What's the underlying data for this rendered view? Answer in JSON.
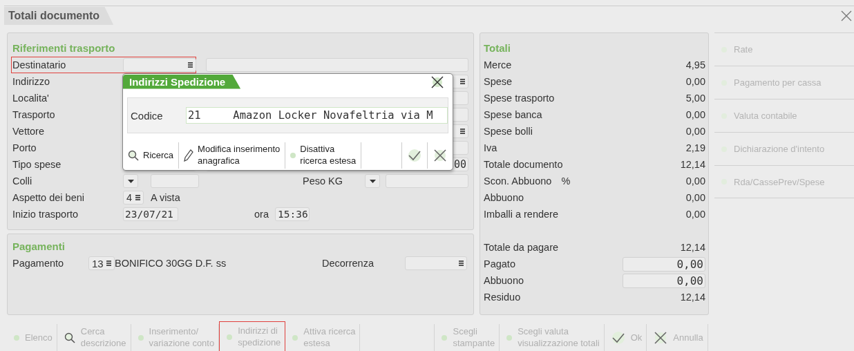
{
  "window": {
    "title": "Totali documento"
  },
  "transport": {
    "title": "Riferimenti trasporto",
    "rows": [
      {
        "kind": "lookup",
        "label": "Destinatario",
        "highlighted": true,
        "wide_menu": false
      },
      {
        "kind": "lookup",
        "label": "Indirizzo",
        "highlighted": false,
        "wide_menu": true
      },
      {
        "kind": "lookup",
        "label": "Localita'",
        "highlighted": false,
        "wide_menu": false
      },
      {
        "kind": "lookup",
        "label": "Trasporto",
        "highlighted": false,
        "wide_menu": false
      },
      {
        "kind": "lookup",
        "label": "Vettore",
        "highlighted": false,
        "wide_menu": true
      },
      {
        "kind": "lookup",
        "label": "Porto",
        "highlighted": false,
        "wide_menu": false
      },
      {
        "kind": "lookup",
        "label": "Tipo spese",
        "highlighted": false,
        "wide_menu": false,
        "value": "00"
      },
      {
        "kind": "pair",
        "label": "Colli",
        "label2": "Peso KG",
        "highlighted": false
      },
      {
        "kind": "code",
        "label": "Aspetto dei beni",
        "code": "4",
        "description": "A vista",
        "highlighted": false
      },
      {
        "kind": "datetime",
        "label": "Inizio trasporto",
        "date": "23/07/21",
        "label2": "ora",
        "time": "15:36",
        "highlighted": false
      }
    ]
  },
  "popup": {
    "title": "Indirizzi Spedizione",
    "code_label": "Codice",
    "code_value": "21     Amazon Locker Novafeltria via M",
    "tools": [
      {
        "kind": "search",
        "label": "Ricerca"
      },
      {
        "kind": "pencil",
        "label": "Modifica inserimento\nanagrafica"
      },
      {
        "kind": "dot",
        "label": "Disattiva\nricerca estesa"
      },
      {
        "kind": "empty"
      },
      {
        "kind": "check"
      },
      {
        "kind": "cross"
      }
    ]
  },
  "payments": {
    "title": "Pagamenti",
    "label": "Pagamento",
    "code": "13",
    "description": "BONIFICO 30GG D.F. ss",
    "label2": "Decorrenza"
  },
  "totals": {
    "title": "Totali",
    "rows": [
      {
        "kind": "value",
        "label": "Merce",
        "value": "4,95"
      },
      {
        "kind": "value",
        "label": "Spese",
        "value": "0,00"
      },
      {
        "kind": "value",
        "label": "Spese trasporto",
        "value": "5,00"
      },
      {
        "kind": "value",
        "label": "Spese banca",
        "value": "0,00"
      },
      {
        "kind": "value",
        "label": "Spese bolli",
        "value": "0,00"
      },
      {
        "kind": "value",
        "label": "Iva",
        "value": "2,19"
      },
      {
        "kind": "value",
        "label": "Totale documento",
        "value": "12,14"
      },
      {
        "kind": "value",
        "label": "Scon. Abbuono",
        "unit": "%",
        "value": "0,00"
      },
      {
        "kind": "value",
        "label": "Abbuono",
        "value": "0,00"
      },
      {
        "kind": "value",
        "label": "Imballi a rendere",
        "value": "0,00"
      },
      {
        "kind": "gap"
      },
      {
        "kind": "value",
        "label": "Totale da pagare",
        "value": "12,14"
      },
      {
        "kind": "input",
        "label": "Pagato",
        "value": "0,00"
      },
      {
        "kind": "input",
        "label": "Abbuono",
        "value": "0,00"
      },
      {
        "kind": "value",
        "label": "Residuo",
        "value": "12,14"
      }
    ]
  },
  "side_buttons": [
    {
      "label": "Rate",
      "disabled": true
    },
    {
      "label": "Pagamento per cassa",
      "disabled": true
    },
    {
      "label": "Valuta contabile",
      "disabled": true
    },
    {
      "label": "Dichiarazione d'intento",
      "disabled": true
    },
    {
      "label": "Rda/CassePrev/Spese",
      "disabled": true
    }
  ],
  "toolbar": [
    {
      "kind": "dot",
      "label": "Elenco",
      "disabled": true,
      "highlighted": false
    },
    {
      "kind": "search",
      "label": "Cerca\ndescrizione",
      "disabled": true,
      "highlighted": false
    },
    {
      "kind": "dot",
      "label": "Inserimento/\nvariazione conto",
      "disabled": true,
      "highlighted": false
    },
    {
      "kind": "dot",
      "label": "Indirizzi di\nspedizione",
      "disabled": true,
      "highlighted": true
    },
    {
      "kind": "dot",
      "label": "Attiva ricerca\nestesa",
      "disabled": true,
      "highlighted": false
    },
    {
      "kind": "empty"
    },
    {
      "kind": "dot",
      "label": "Scegli\nstampante",
      "disabled": true,
      "highlighted": false
    },
    {
      "kind": "dot",
      "label": "Scegli valuta\nvisualizzazione totali",
      "disabled": true,
      "highlighted": false
    },
    {
      "kind": "check",
      "label": "Ok",
      "disabled": true,
      "highlighted": false
    },
    {
      "kind": "cross",
      "label": "Annulla",
      "disabled": true,
      "highlighted": false
    }
  ]
}
